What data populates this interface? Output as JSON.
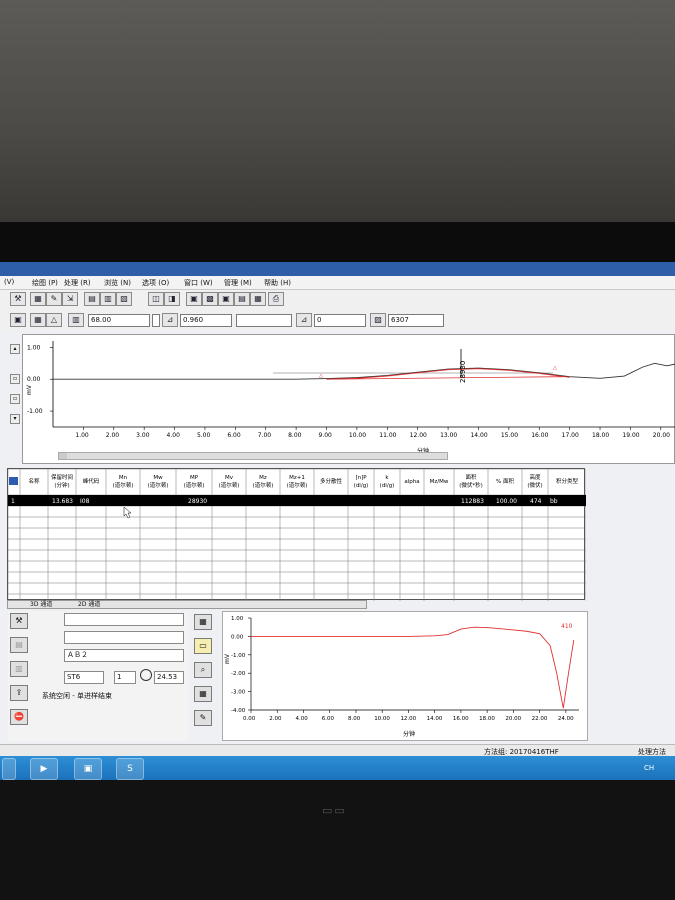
{
  "menu": [
    "(V)",
    "绘图 (P)",
    "处理 (R)",
    "浏览 (N)",
    "选项 (O)",
    "窗口 (W)",
    "管理 (M)",
    "帮助 (H)"
  ],
  "toolbar2": {
    "field1": "68.00",
    "field2": "0.960",
    "field3": "0",
    "field4": "6307"
  },
  "top_chart": {
    "xlabel": "分钟",
    "ylabel": "mV",
    "x_ticks": [
      "1.00",
      "2.00",
      "3.00",
      "4.00",
      "5.00",
      "6.00",
      "7.00",
      "8.00",
      "9.00",
      "10.00",
      "11.00",
      "12.00",
      "13.00",
      "14.00",
      "15.00",
      "16.00",
      "17.00",
      "18.00",
      "19.00",
      "20.00"
    ],
    "y_ticks": [
      "1.00",
      "0.00",
      "-1.00"
    ],
    "peak_label": "28930"
  },
  "table": {
    "headers": [
      "名称",
      "保留时间\n(分钟)",
      "峰代码",
      "Mn\n(道尔顿)",
      "Mw\n(道尔顿)",
      "MP\n(道尔顿)",
      "Mv\n(道尔顿)",
      "Mz\n(道尔顿)",
      "Mz+1\n(道尔顿)",
      "多分散性",
      "[n]P\n(dl/g)",
      "k\n(dl/g)",
      "alpha",
      "Mz/Mw",
      "面积\n(微伏*秒)",
      "% 面积",
      "高度\n(微伏)",
      "积分类型"
    ],
    "row1": {
      "index": "1",
      "rt": "13.683",
      "code": "I08",
      "mp": "28930",
      "area": "112883",
      "pct": "100.00",
      "height": "474",
      "type": "bb"
    }
  },
  "tabs": [
    "3D 通道",
    "2D 通道"
  ],
  "left_panel": {
    "f3": "ＡＢ２",
    "f4a": "ST6",
    "f4b": "1",
    "time": "24.53",
    "status": "系统空闲 - 单进样结束"
  },
  "bottom_chart": {
    "xlabel": "分钟",
    "ylabel": "mV",
    "series_label": "410",
    "x_ticks": [
      "0.00",
      "2.00",
      "4.00",
      "6.00",
      "8.00",
      "10.00",
      "12.00",
      "14.00",
      "16.00",
      "18.00",
      "20.00",
      "22.00",
      "24.00"
    ],
    "y_ticks": [
      "1.00",
      "0.00",
      "-1.00",
      "-2.00",
      "-3.00",
      "-4.00"
    ]
  },
  "status_bar": {
    "method": "方法组: 20170416THF",
    "right": "处理方法"
  },
  "taskbar": {
    "lang": "CH"
  },
  "chart_data": [
    {
      "type": "line",
      "title": "",
      "xlabel": "分钟",
      "ylabel": "mV",
      "xlim": [
        0,
        20.5
      ],
      "ylim": [
        -1.5,
        1.2
      ],
      "series": [
        {
          "values": [
            [
              0,
              0
            ],
            [
              8,
              0
            ],
            [
              9,
              0.02
            ],
            [
              10,
              0.05
            ],
            [
              11,
              0.12
            ],
            [
              12,
              0.22
            ],
            [
              13,
              0.32
            ],
            [
              14,
              0.35
            ],
            [
              15,
              0.3
            ],
            [
              16,
              0.2
            ],
            [
              17,
              0.08
            ],
            [
              18,
              0.03
            ],
            [
              18.8,
              0.1
            ],
            [
              19.4,
              0.38
            ],
            [
              19.8,
              0.5
            ],
            [
              20.2,
              0.42
            ],
            [
              20.5,
              0.48
            ]
          ]
        }
      ],
      "annotations": [
        "28930"
      ]
    },
    {
      "type": "line",
      "title": "",
      "xlabel": "分钟",
      "ylabel": "mV",
      "xlim": [
        0,
        25
      ],
      "ylim": [
        -4,
        1
      ],
      "series": [
        {
          "name": "410",
          "values": [
            [
              0,
              0
            ],
            [
              12,
              0
            ],
            [
              14,
              0.03
            ],
            [
              15,
              0.1
            ],
            [
              16,
              0.4
            ],
            [
              17,
              0.5
            ],
            [
              18,
              0.48
            ],
            [
              19,
              0.42
            ],
            [
              20,
              0.35
            ],
            [
              21,
              0.28
            ],
            [
              22,
              0.15
            ],
            [
              22.8,
              -0.5
            ],
            [
              23.3,
              -2
            ],
            [
              23.8,
              -3.9
            ],
            [
              24.2,
              -2
            ],
            [
              24.6,
              -0.2
            ]
          ]
        }
      ]
    }
  ]
}
